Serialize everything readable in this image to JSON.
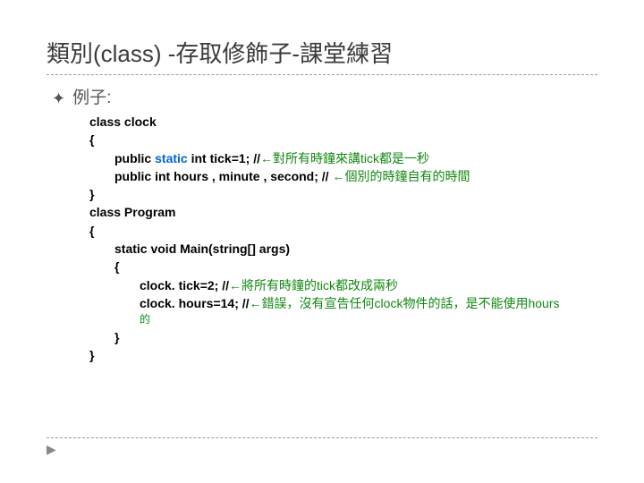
{
  "title": "類別(class) -存取修飾子-課堂練習",
  "bullet": "例子:",
  "code": {
    "l1": "class clock",
    "l2": "{",
    "l3a": "public ",
    "l3b": "static",
    "l3c": " int tick=1; //",
    "l3d": "←對所有時鐘來講tick都是一秒",
    "l4a": "public int hours , minute , second; // ",
    "l4b": "←個別的時鐘自有的時間",
    "l5": "}",
    "l6": "class Program",
    "l7": "{",
    "l8": "static void Main(string[] args)",
    "l9": "{",
    "l10a": "clock. tick=2; //",
    "l10b": "←將所有時鐘的tick都改成兩秒",
    "l11a": "clock. hours=14; //",
    "l11b": "←錯誤，沒有宣告任何clock物件的話，是不能使用hours",
    "l11c": "的",
    "l12": "}",
    "l13": "}"
  }
}
